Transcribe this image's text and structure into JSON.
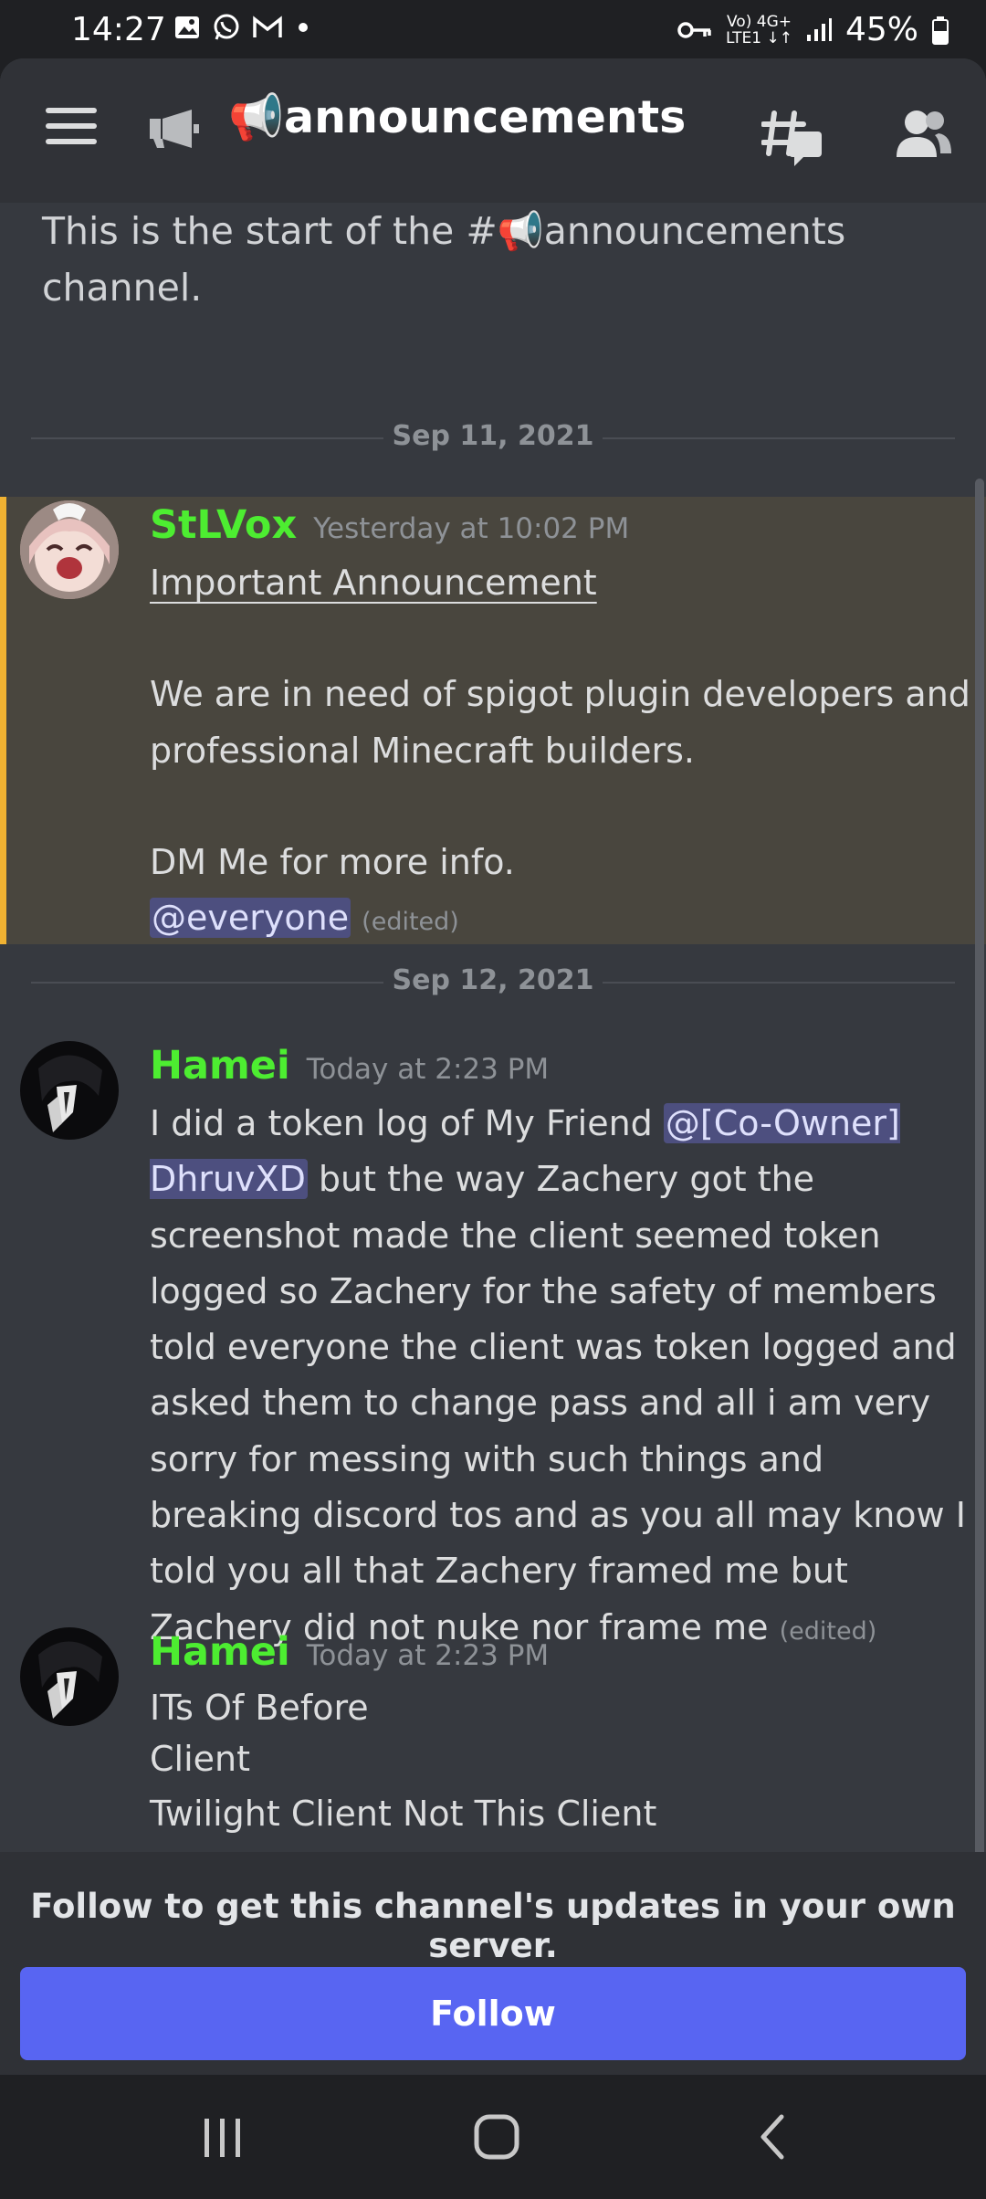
{
  "status_bar": {
    "time": "14:27",
    "notification_icons": [
      "gallery-icon",
      "whatsapp-icon",
      "gmail-icon",
      "dot-icon"
    ],
    "network_top": "Vo) 4G+",
    "network_bottom": "LTE1 ↓↑",
    "battery": "45%"
  },
  "header": {
    "channel_name": "📢announcements",
    "icons": [
      "menu-icon",
      "announcement-channel-icon",
      "threads-icon",
      "members-icon"
    ]
  },
  "channel_start": {
    "text": "This is the start of the #📢announcements channel."
  },
  "dividers": [
    {
      "date": "Sep 11, 2021"
    },
    {
      "date": "Sep 12, 2021"
    }
  ],
  "messages": [
    {
      "author": "StLVox",
      "timestamp": "Yesterday at 10:02 PM",
      "heading": "Important Announcement",
      "para1": "We are in need of spigot plugin developers and professional Minecraft builders.",
      "para2": "DM Me for more info.",
      "mention": "@everyone",
      "edited": "(edited)",
      "author_color": "#4ded31"
    },
    {
      "author": "Hamei",
      "timestamp": "Today at 2:23 PM",
      "text_before": "I did a token log of My Friend ",
      "mention": "@[Co-Owner] DhruvXD",
      "text_after": " but the way Zachery got the screenshot made the client seemed token logged so Zachery for the safety of members told everyone the client was token logged and asked them to change pass and all i am very sorry for messing with such things and breaking discord tos and as you all may know I told you all that Zachery framed me but Zachery did not nuke nor frame me",
      "edited": "(edited)"
    },
    {
      "author": "Hamei",
      "timestamp": "Today at 2:23 PM",
      "line1": "ITs Of Before",
      "line2": "Client",
      "line3": "Twilight Client Not This Client"
    }
  ],
  "follow": {
    "prompt": "Follow to get this channel's updates in your own server.",
    "button": "Follow"
  },
  "colors": {
    "background": "#36393f",
    "header": "#303237",
    "highlight": "#49463e",
    "highlight_bar": "#f0b232",
    "mention_bg": "#4d4f7f",
    "button": "#5865f2",
    "author": "#4ded31"
  },
  "nav_bar": [
    "recents-icon",
    "home-icon",
    "back-icon"
  ]
}
